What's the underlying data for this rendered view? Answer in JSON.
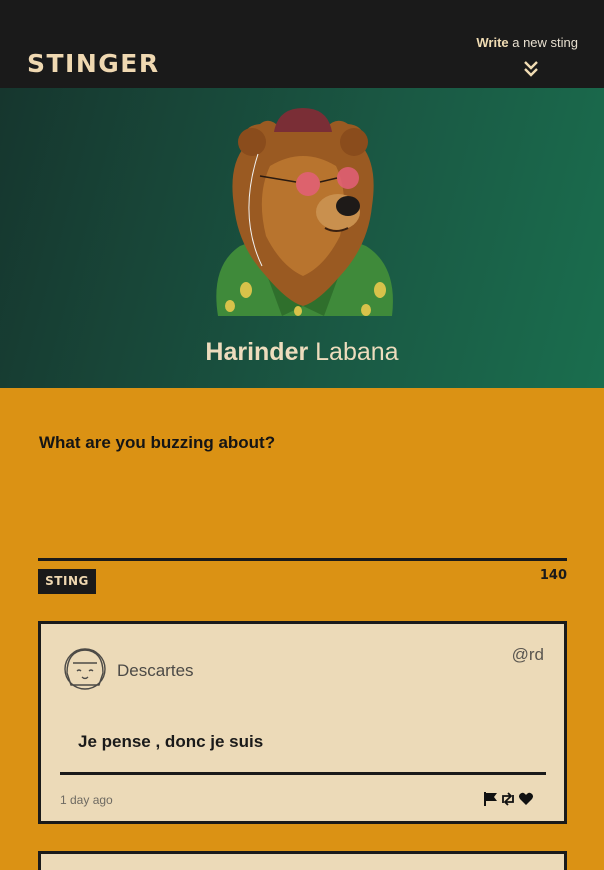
{
  "header": {
    "logo": "STINGER",
    "write_bold": "Write",
    "write_rest": " a new sting"
  },
  "profile": {
    "first_name": "Harinder",
    "last_name": "Labana"
  },
  "compose": {
    "prompt": "What are you buzzing about?",
    "button_label": "STING",
    "char_count": "140"
  },
  "stings": [
    {
      "author": "Descartes",
      "handle": "@rd",
      "text": "Je pense , donc je suis",
      "time": "1 day ago"
    }
  ],
  "colors": {
    "background": "#db9214",
    "header": "#1a1a1a",
    "card": "#ecdab8",
    "accent_cream": "#efd8b1",
    "hero_green": "#1a5944"
  },
  "icons": [
    "chevron-double-down-icon",
    "flag-icon",
    "retweet-icon",
    "heart-icon"
  ]
}
